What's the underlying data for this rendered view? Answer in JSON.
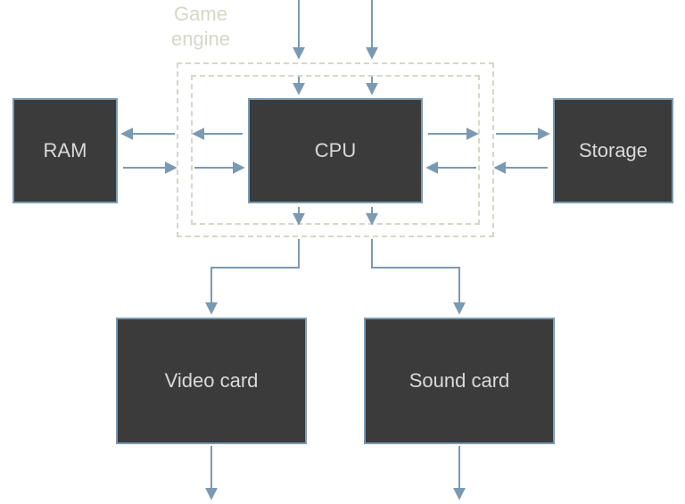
{
  "diagram": {
    "title": "Game\nengine",
    "nodes": {
      "ram": {
        "label": "RAM"
      },
      "cpu": {
        "label": "CPU"
      },
      "storage": {
        "label": "Storage"
      },
      "video": {
        "label": "Video card"
      },
      "sound": {
        "label": "Sound card"
      }
    },
    "edges": [
      {
        "from": "external-top-left",
        "to": "cpu",
        "dir": "in"
      },
      {
        "from": "external-top-right",
        "to": "cpu",
        "dir": "in"
      },
      {
        "from": "ram",
        "to": "cpu",
        "dir": "both"
      },
      {
        "from": "cpu",
        "to": "storage",
        "dir": "both"
      },
      {
        "from": "cpu",
        "to": "video",
        "dir": "out"
      },
      {
        "from": "cpu",
        "to": "sound",
        "dir": "out"
      },
      {
        "from": "video",
        "to": "external-bottom-left",
        "dir": "out"
      },
      {
        "from": "sound",
        "to": "external-bottom-right",
        "dir": "out"
      }
    ],
    "wrappers": [
      {
        "name": "game-engine-outer",
        "around": "cpu"
      },
      {
        "name": "game-engine-inner",
        "around": "cpu"
      }
    ],
    "colors": {
      "box_fill": "#3b3b3b",
      "box_border": "#7a9ab3",
      "box_text": "#d9d9d9",
      "arrow": "#7a9ab3",
      "dashed": "#d7d7c7"
    }
  }
}
